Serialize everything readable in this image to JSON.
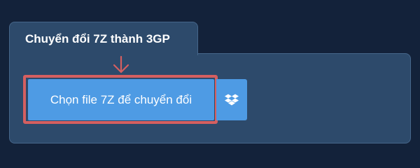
{
  "converter": {
    "tab_title": "Chuyển đổi 7Z thành 3GP",
    "choose_file_label": "Chọn file 7Z để chuyển đổi",
    "dropbox_icon": "dropbox-icon",
    "arrow_icon": "arrow-down-icon"
  },
  "colors": {
    "page_background": "#13223a",
    "panel_background": "#2d4a6b",
    "panel_border": "#46668a",
    "button_background": "#4e9be4",
    "highlight_red": "#d55f60",
    "text": "#ffffff"
  }
}
